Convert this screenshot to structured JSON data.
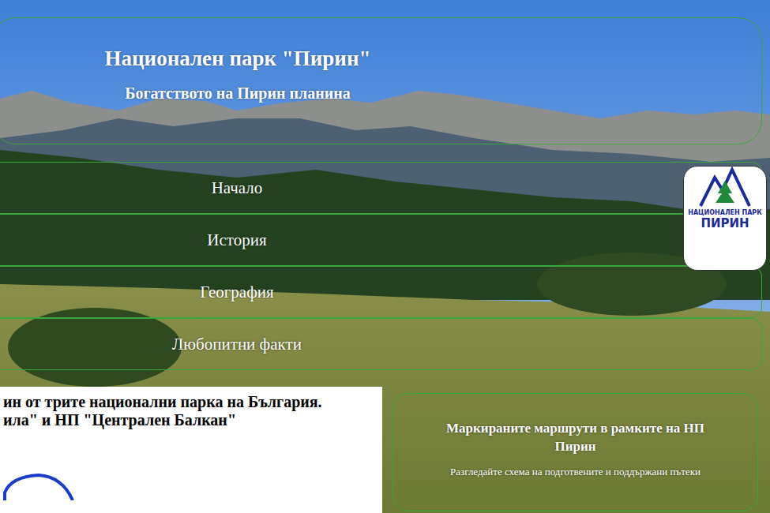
{
  "header": {
    "title": "Национален парк \"Пирин\"",
    "subtitle": "Богатството на Пирин планина"
  },
  "nav": [
    {
      "label": "Начало"
    },
    {
      "label": "История"
    },
    {
      "label": "География"
    },
    {
      "label": "Любопитни факти"
    }
  ],
  "logo": {
    "top": "НАЦИОНАЛЕН ПАРК",
    "bottom": "ПИРИН"
  },
  "intro": {
    "lines": [
      "ин от трите национални парка на България.",
      "ила\" и НП \"Централен Балкан\""
    ]
  },
  "routes": {
    "title": "Маркираните маршрути в рамките на НП Пирин",
    "description": "Разгледайте схема на подготвените и поддържани пътеки"
  }
}
